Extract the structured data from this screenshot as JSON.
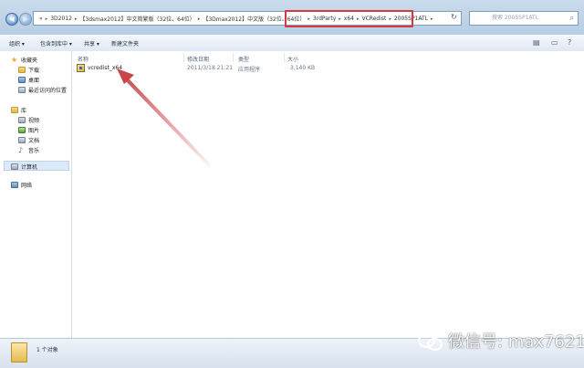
{
  "address": {
    "crumbs": [
      "3D2012",
      "【3dsmax2012】中文简繁版（32位、64位）",
      "【3Dmax2012】中文版（32位、64位）",
      "3rdParty",
      "x64",
      "VCRedist",
      "2005SP1ATL"
    ],
    "lead": "«",
    "search_placeholder": "搜索 2005SP1ATL"
  },
  "toolbar": {
    "organize": "组织 ▾",
    "include_in_library": "包含到库中 ▾",
    "share": "共享 ▾",
    "new_folder": "新建文件夹"
  },
  "nav": {
    "favorites": "收藏夹",
    "downloads": "下载",
    "desktop": "桌面",
    "recent": "最近访问的位置",
    "libraries": "库",
    "videos": "视频",
    "pictures": "图片",
    "documents": "文档",
    "music": "音乐",
    "computer": "计算机",
    "network": "网络"
  },
  "columns": {
    "name": "名称",
    "date": "修改日期",
    "type": "类型",
    "size": "大小"
  },
  "files": [
    {
      "name": "vcredist_x64",
      "date": "2011/3/18 21:21",
      "type": "应用程序",
      "size": "3,140 KB"
    }
  ],
  "status": {
    "count": "1 个对象"
  },
  "watermark": {
    "text": "微信号: max7621"
  },
  "colors": {
    "highlight": "#d8373e",
    "arrow": "#c9454a"
  }
}
